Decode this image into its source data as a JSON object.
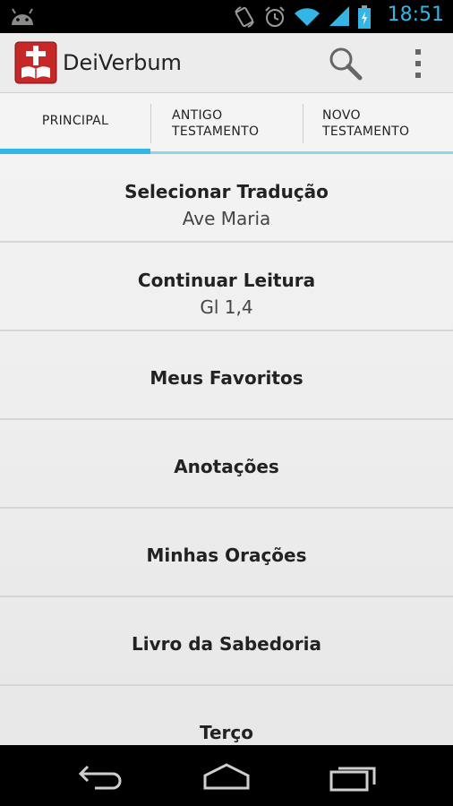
{
  "status_bar": {
    "time": "18:51",
    "icons": [
      "android-icon",
      "rotate-icon",
      "alarm-icon",
      "wifi-icon",
      "signal-icon",
      "battery-icon"
    ]
  },
  "app": {
    "title": "DeiVerbum",
    "icon": "bible-cross-icon"
  },
  "actions": {
    "search_icon": "search-icon",
    "overflow_icon": "overflow-menu-icon"
  },
  "tabs": [
    {
      "label": "PRINCIPAL",
      "active": true
    },
    {
      "label": "ANTIGO\nTESTAMENTO",
      "active": false
    },
    {
      "label": "NOVO\nTESTAMENTO",
      "active": false
    }
  ],
  "menu": [
    {
      "title": "Selecionar Tradução",
      "subtitle": "Ave Maria"
    },
    {
      "title": "Continuar Leitura",
      "subtitle": "Gl 1,4"
    },
    {
      "title": "Meus Favoritos"
    },
    {
      "title": "Anotações"
    },
    {
      "title": "Minhas Orações"
    },
    {
      "title": "Livro da Sabedoria"
    },
    {
      "title": "Terço"
    }
  ],
  "nav": [
    "back-icon",
    "home-icon",
    "recent-apps-icon"
  ],
  "colors": {
    "accent": "#33b5e5",
    "accent_light": "#91d4ee",
    "icon_red": "#c62828"
  }
}
